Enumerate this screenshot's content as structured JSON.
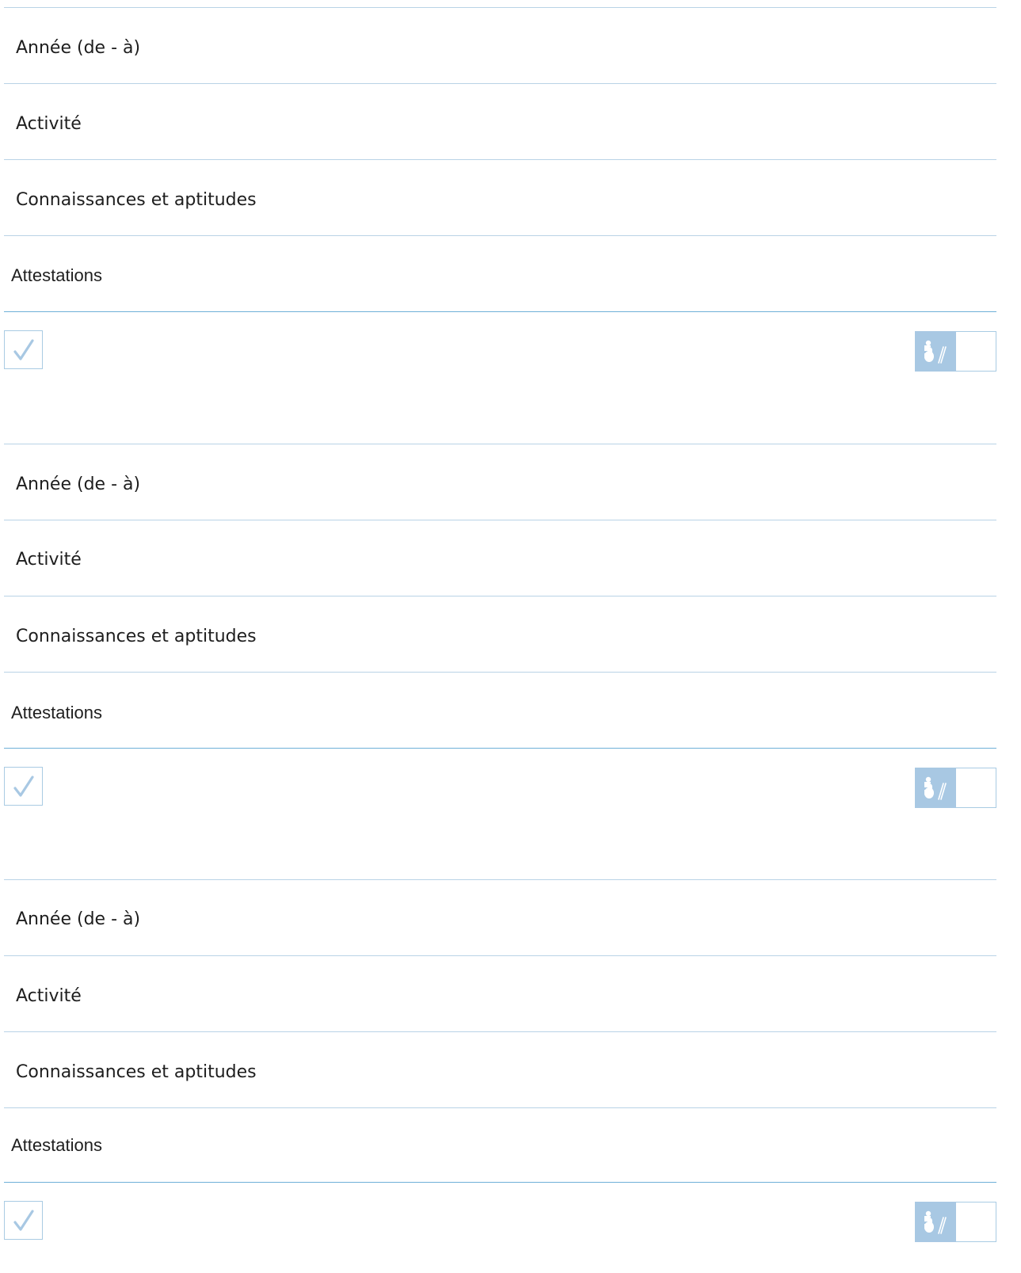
{
  "colors": {
    "line": "#b9d3e6",
    "line_strong": "#6fb0d8",
    "icon_bg": "#a8c8e3",
    "check": "#a8c8e3"
  },
  "icons": {
    "check": "checkmark-icon",
    "signature": "signature-icon"
  },
  "entries": [
    {
      "year_label": "Année (de - à)",
      "activity_label": "Activité",
      "skills_label": "Connaissances et aptitudes",
      "attestations_label": "Attestations"
    },
    {
      "year_label": "Année (de - à)",
      "activity_label": "Activité",
      "skills_label": "Connaissances et aptitudes",
      "attestations_label": "Attestations"
    },
    {
      "year_label": "Année (de - à)",
      "activity_label": "Activité",
      "skills_label": "Connaissances et aptitudes",
      "attestations_label": "Attestations"
    }
  ]
}
